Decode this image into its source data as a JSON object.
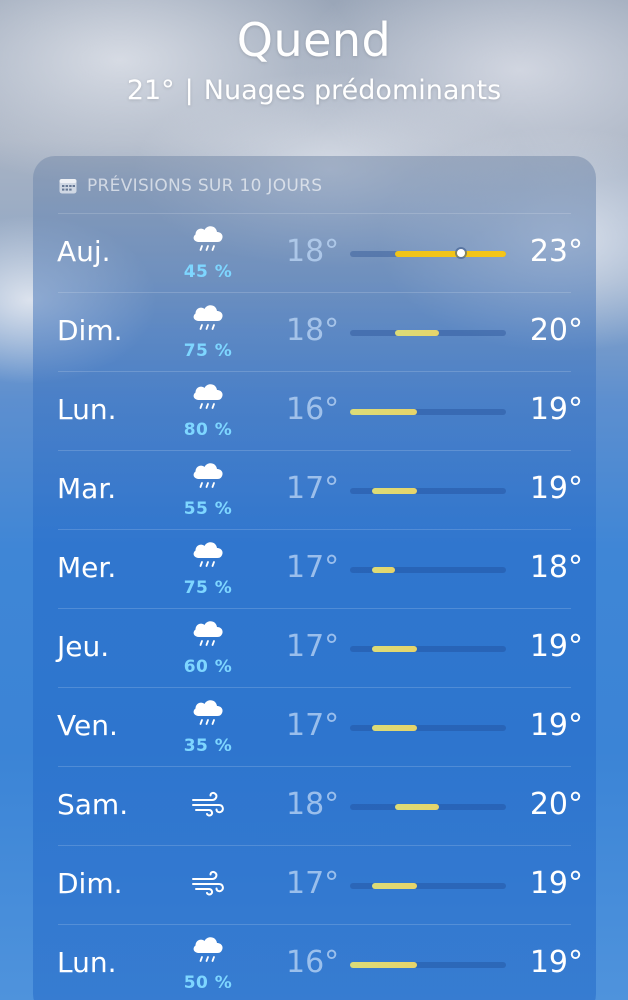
{
  "location": {
    "city": "Quend",
    "current_temp": "21°",
    "separator": "|",
    "condition": "Nuages prédominants"
  },
  "forecast": {
    "header": "PRÉVISIONS SUR 10 JOURS",
    "header_icon": "calendar-icon",
    "range_min": 16,
    "range_max": 23,
    "current_temp_value": 21,
    "days": [
      {
        "day": "Auj.",
        "icon": "cloud-rain-icon",
        "precip": "45 %",
        "low": "18°",
        "high": "23°",
        "low_value": 18,
        "high_value": 23,
        "today": true
      },
      {
        "day": "Dim.",
        "icon": "cloud-rain-icon",
        "precip": "75 %",
        "low": "18°",
        "high": "20°",
        "low_value": 18,
        "high_value": 20,
        "today": false
      },
      {
        "day": "Lun.",
        "icon": "cloud-rain-icon",
        "precip": "80 %",
        "low": "16°",
        "high": "19°",
        "low_value": 16,
        "high_value": 19,
        "today": false
      },
      {
        "day": "Mar.",
        "icon": "cloud-rain-icon",
        "precip": "55 %",
        "low": "17°",
        "high": "19°",
        "low_value": 17,
        "high_value": 19,
        "today": false
      },
      {
        "day": "Mer.",
        "icon": "cloud-rain-icon",
        "precip": "75 %",
        "low": "17°",
        "high": "18°",
        "low_value": 17,
        "high_value": 18,
        "today": false
      },
      {
        "day": "Jeu.",
        "icon": "cloud-rain-icon",
        "precip": "60 %",
        "low": "17°",
        "high": "19°",
        "low_value": 17,
        "high_value": 19,
        "today": false
      },
      {
        "day": "Ven.",
        "icon": "cloud-rain-icon",
        "precip": "35 %",
        "low": "17°",
        "high": "19°",
        "low_value": 17,
        "high_value": 19,
        "today": false
      },
      {
        "day": "Sam.",
        "icon": "wind-icon",
        "precip": "",
        "low": "18°",
        "high": "20°",
        "low_value": 18,
        "high_value": 20,
        "today": false
      },
      {
        "day": "Dim.",
        "icon": "wind-icon",
        "precip": "",
        "low": "17°",
        "high": "19°",
        "low_value": 17,
        "high_value": 19,
        "today": false
      },
      {
        "day": "Lun.",
        "icon": "cloud-rain-icon",
        "precip": "50 %",
        "low": "16°",
        "high": "19°",
        "low_value": 16,
        "high_value": 19,
        "today": false
      }
    ]
  },
  "colors": {
    "precip_text": "#7ed6ff",
    "bar_today": "#f5c518",
    "bar_normal": "#dcdc78"
  }
}
